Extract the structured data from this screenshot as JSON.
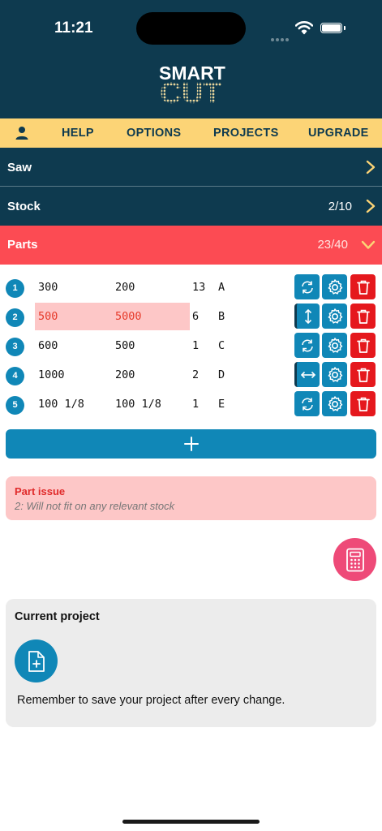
{
  "status_bar": {
    "time": "11:21"
  },
  "logo": {
    "line1": "SMART",
    "line2": "CUT"
  },
  "nav": {
    "help": "HELP",
    "options": "OPTIONS",
    "projects": "PROJECTS",
    "upgrade": "UPGRADE"
  },
  "sections": {
    "saw": {
      "label": "Saw"
    },
    "stock": {
      "label": "Stock",
      "count": "2/10"
    },
    "parts": {
      "label": "Parts",
      "count": "23/40"
    }
  },
  "parts": [
    {
      "index": "1",
      "length": "300",
      "width": "200",
      "qty": "13",
      "name": "A",
      "rotation": "rotate"
    },
    {
      "index": "2",
      "length": "500",
      "width": "5000",
      "qty": "6",
      "name": "B",
      "rotation": "vertical",
      "error": true
    },
    {
      "index": "3",
      "length": "600",
      "width": "500",
      "qty": "1",
      "name": "C",
      "rotation": "rotate"
    },
    {
      "index": "4",
      "length": "1000",
      "width": "200",
      "qty": "2",
      "name": "D",
      "rotation": "horizontal"
    },
    {
      "index": "5",
      "length": "100 1/8",
      "width": "100 1/8",
      "qty": "1",
      "name": "E",
      "rotation": "rotate"
    }
  ],
  "issue": {
    "title": "Part issue",
    "detail": "2: Will not fit on any relevant stock"
  },
  "project": {
    "title": "Current project",
    "message": "Remember to save your project after every change."
  },
  "colors": {
    "header": "#0e3a4f",
    "nav": "#fcd476",
    "parts_bar": "#fc4b53",
    "accent_blue": "#1087b7",
    "danger": "#e5181d",
    "calculator": "#ee4a78"
  }
}
